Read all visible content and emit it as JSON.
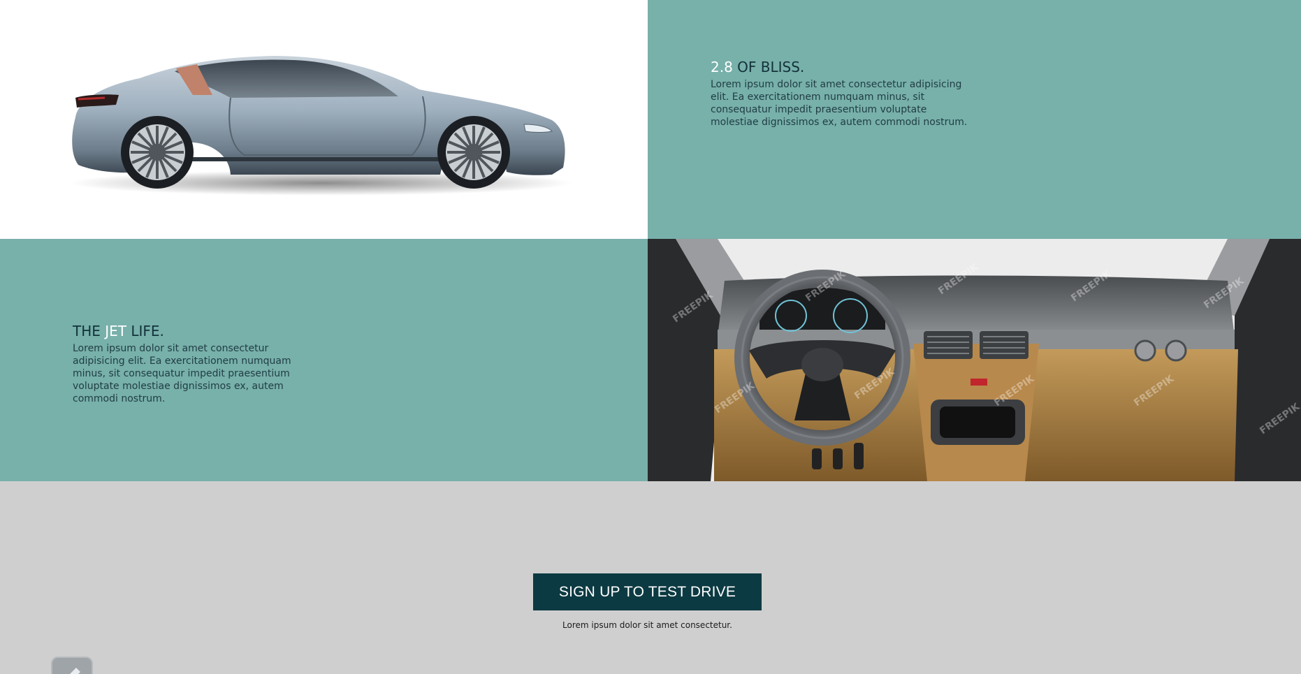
{
  "sections": {
    "bliss": {
      "heading_highlight": "2.8",
      "heading_rest": " OF BLISS.",
      "body": "Lorem ipsum dolor sit amet consectetur adipisicing elit. Ea exercitationem numquam minus, sit consequatur impedit praesentium voluptate molestiae dignissimos ex, autem commodi nostrum."
    },
    "jet": {
      "heading_before": "THE ",
      "heading_highlight": "JET",
      "heading_after": " LIFE.",
      "body": "Lorem ipsum dolor sit amet consectetur adipisicing elit. Ea exercitationem numquam minus, sit consequatur impedit praesentium voluptate molestiae dignissimos ex, autem commodi nostrum."
    }
  },
  "images": {
    "car": "sports-car-side-view",
    "interior": "car-interior-dashboard",
    "watermark": "FREEPIK"
  },
  "cta": {
    "label": "SIGN UP TO TEST DRIVE",
    "subtext": "Lorem ipsum dolor sit amet consectetur."
  },
  "colors": {
    "teal": "#78b0aa",
    "dark_teal": "#0c3a42",
    "footer_bg": "#cfcfcf",
    "highlight": "#ffffff"
  }
}
